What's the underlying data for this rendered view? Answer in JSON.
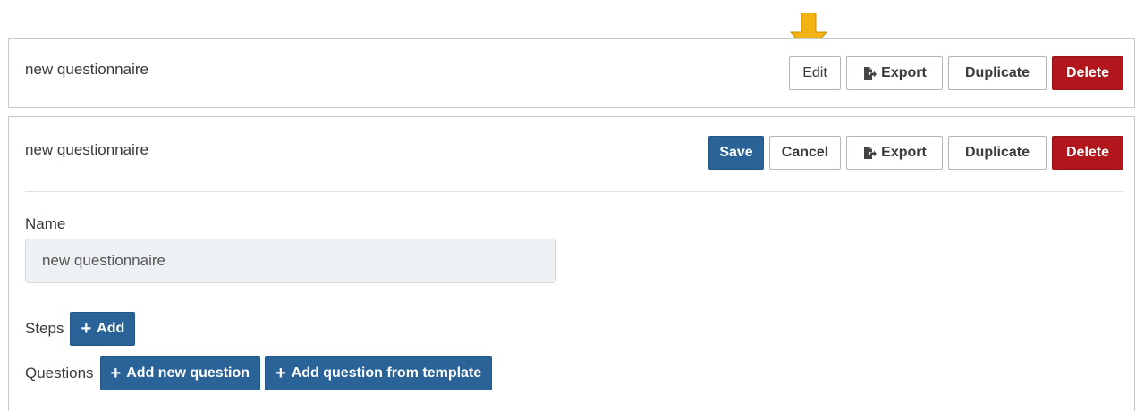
{
  "view_panel": {
    "title": "new questionnaire",
    "buttons": {
      "edit": "Edit",
      "export": "Export",
      "duplicate": "Duplicate",
      "delete": "Delete"
    }
  },
  "edit_panel": {
    "title": "new questionnaire",
    "buttons": {
      "save": "Save",
      "cancel": "Cancel",
      "export": "Export",
      "duplicate": "Duplicate",
      "delete": "Delete"
    },
    "name_field": {
      "label": "Name",
      "value": "new questionnaire"
    },
    "steps": {
      "label": "Steps",
      "add_button": "Add"
    },
    "questions": {
      "label": "Questions",
      "add_new_button": "Add new question",
      "add_from_template_button": "Add question from template"
    }
  },
  "colors": {
    "primary": "#2a6397",
    "danger": "#b0161b",
    "annotation_arrow": "#f2b211"
  },
  "icons": [
    "export-icon",
    "plus-icon",
    "arrow-down-icon"
  ]
}
